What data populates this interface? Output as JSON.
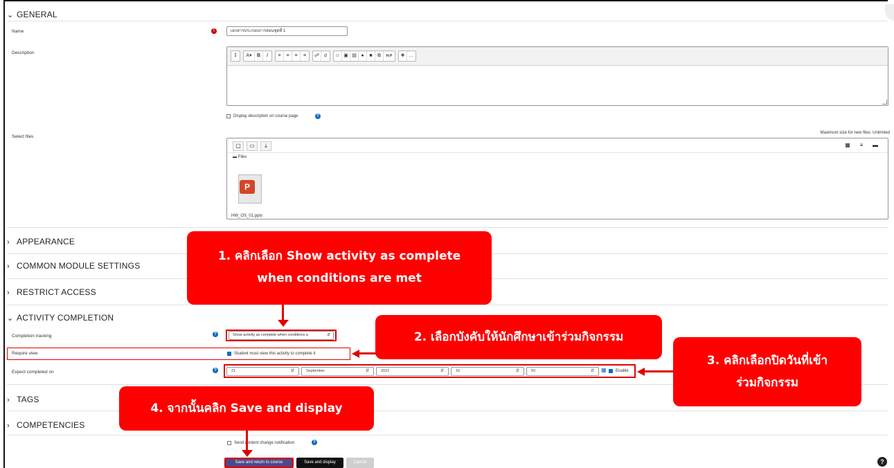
{
  "sections": {
    "general": "GENERAL",
    "appearance": "APPEARANCE",
    "common_module": "COMMON MODULE SETTINGS",
    "restrict_access": "RESTRICT ACCESS",
    "activity_completion": "ACTIVITY COMPLETION",
    "tags": "TAGS",
    "competencies": "COMPETENCIES"
  },
  "form": {
    "name_label": "Name",
    "name_value": "เอกสารประกอบการสอนชุดที่ 1",
    "description_label": "Description",
    "display_description": "Display description on course page",
    "select_files_label": "Select files",
    "max_size": "Maximum size for new files: Unlimited",
    "files_folder": "Files",
    "file_name": "HW_OS_01.pptx",
    "completion_tracking_label": "Completion tracking",
    "completion_tracking_value": "Show activity as complete when conditions a",
    "require_view_label": "Require view",
    "require_view_text": "Student must view this activity to complete it",
    "expect_completed_label": "Expect completed on",
    "date_day": "21",
    "date_month": "September",
    "date_year": "2022",
    "date_hour": "16",
    "date_minute": "50",
    "enable_label": "Enable",
    "send_notification": "Send content change notification"
  },
  "buttons": {
    "save_return": "Save and return to course",
    "save_display": "Save and display",
    "cancel": "Cancel"
  },
  "callouts": {
    "c1_line1": "1. คลิกเลือก Show activity as complete",
    "c1_line2": "when conditions  are met",
    "c2": "2. เลือกบังคับให้นักศึกษาเข้าร่วมกิจกรรม",
    "c3_line1": "3. คลิกเลือกปิดวันที่เข้า",
    "c3_line2": "ร่วมกิจกรรม",
    "c4": "4. จากนั้นคลิก Save and display"
  },
  "colors": {
    "callout": "#ff0000",
    "primary": "#0f6cbf",
    "save_return_bg": "#4a4a8a",
    "save_display_bg": "#111111",
    "cancel_bg": "#cfcfcf"
  }
}
